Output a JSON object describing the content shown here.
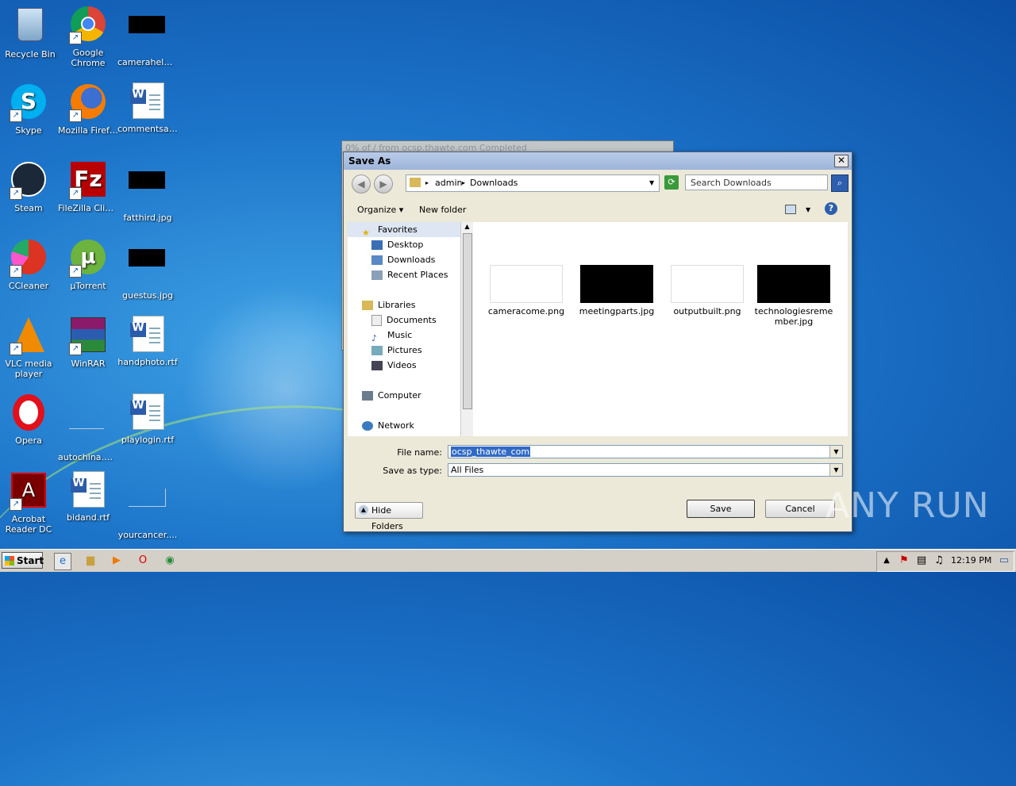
{
  "desktop": {
    "icons": [
      {
        "label": "Recycle Bin"
      },
      {
        "label": "Google Chrome"
      },
      {
        "label": "cameraheld...."
      },
      {
        "label": "Skype"
      },
      {
        "label": "Mozilla Firefox"
      },
      {
        "label": "commentsas..."
      },
      {
        "label": "Steam"
      },
      {
        "label": "FileZilla Client"
      },
      {
        "label": "fatthird.jpg"
      },
      {
        "label": "CCleaner"
      },
      {
        "label": "µTorrent"
      },
      {
        "label": "guestus.jpg"
      },
      {
        "label": "VLC media player"
      },
      {
        "label": "WinRAR"
      },
      {
        "label": "handphoto.rtf"
      },
      {
        "label": "Opera"
      },
      {
        "label": "autochina.png"
      },
      {
        "label": "playlogin.rtf"
      },
      {
        "label": "Acrobat Reader DC"
      },
      {
        "label": "bidand.rtf"
      },
      {
        "label": "yourcancer...."
      }
    ]
  },
  "bg_window": {
    "title": "0% of / from ocsp.thawte.com Completed"
  },
  "dialog": {
    "title": "Save As",
    "close_label": "✕",
    "breadcrumb": [
      "admin",
      "Downloads"
    ],
    "search_placeholder": "Search Downloads",
    "organize_label": "Organize",
    "new_folder_label": "New folder",
    "help_label": "?",
    "nav": {
      "favorites": "Favorites",
      "desktop": "Desktop",
      "downloads": "Downloads",
      "recent": "Recent Places",
      "libraries": "Libraries",
      "documents": "Documents",
      "music": "Music",
      "pictures": "Pictures",
      "videos": "Videos",
      "computer": "Computer",
      "network": "Network"
    },
    "files": [
      {
        "name": "cameracome.png"
      },
      {
        "name": "meetingparts.jpg"
      },
      {
        "name": "outputbuilt.png"
      },
      {
        "name": "technologiesremember.jpg"
      }
    ],
    "file_name_label": "File name:",
    "file_name_value": "ocsp_thawte_com",
    "save_type_label": "Save as type:",
    "save_type_value": "All Files",
    "hide_folders_label": "Hide Folders",
    "save_label": "Save",
    "cancel_label": "Cancel"
  },
  "watermark": "ANY RUN",
  "taskbar": {
    "start_label": "Start",
    "clock": "12:19 PM"
  },
  "colors": {
    "accent": "#316ac5",
    "desktop_bg": "#1c74c9"
  }
}
